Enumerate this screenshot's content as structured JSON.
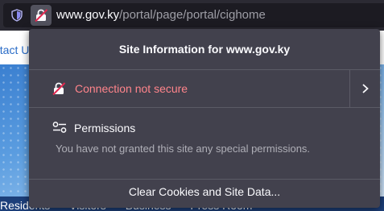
{
  "toolbar": {
    "url_domain": "www.gov.ky",
    "url_path": "/portal/page/portal/cighome",
    "shield_icon": "shield-icon",
    "lock_icon": "insecure-lock-icon"
  },
  "page": {
    "link_text": "ntact U",
    "nav_items": [
      "Residents",
      "Visitors",
      "Business",
      "Press Room"
    ]
  },
  "popup": {
    "title": "Site Information for www.gov.ky",
    "connection_label": "Connection not secure",
    "permissions_title": "Permissions",
    "permissions_desc": "You have not granted this site any special permissions.",
    "clear_button": "Clear Cookies and Site Data..."
  },
  "colors": {
    "panel_bg": "#42414d",
    "insecure_red": "#ff848b",
    "toolbar_bg": "#2b2a33"
  }
}
